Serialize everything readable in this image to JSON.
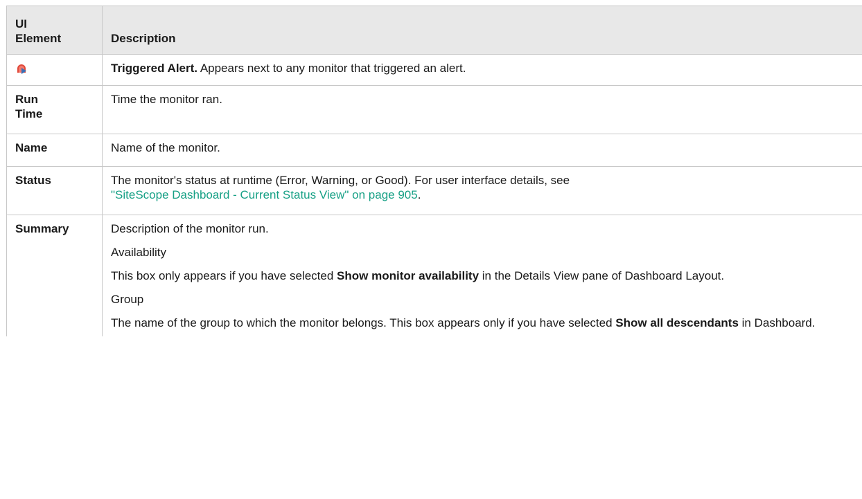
{
  "table": {
    "headers": {
      "element_line1": "UI",
      "element_line2": "Element",
      "description": "Description"
    },
    "rows": {
      "triggered_alert": {
        "icon": "triggered-alert-icon",
        "bold_lead": "Triggered Alert.",
        "text": "Appears next to any monitor that triggered an alert."
      },
      "run_time": {
        "element_line1": "Run",
        "element_line2": "Time",
        "description": "Time the monitor ran."
      },
      "name": {
        "element": "Name",
        "description": "Name of the monitor."
      },
      "status": {
        "element": "Status",
        "text": "The monitor's status at runtime (Error, Warning, or Good). For user interface details, see",
        "link": "\"SiteScope Dashboard - Current Status View\" on page 905",
        "trailing": "."
      },
      "summary": {
        "element": "Summary",
        "p1": "Description of the monitor run.",
        "p2": "Availability",
        "p3_before": "This box only appears if you have selected",
        "p3_bold": "Show monitor availability",
        "p3_after": "in the Details View pane of Dashboard Layout.",
        "p4": "Group",
        "p5_before": "The name of the group to which the monitor belongs. This box appears only if you have selected",
        "p5_bold": "Show all descendants",
        "p5_after": "in Dashboard."
      }
    }
  },
  "colors": {
    "header_bg": "#e8e8e8",
    "border": "#c8c8c8",
    "link": "#16a085",
    "icon_red": "#e0483a",
    "icon_blue": "#3a6fb5"
  }
}
